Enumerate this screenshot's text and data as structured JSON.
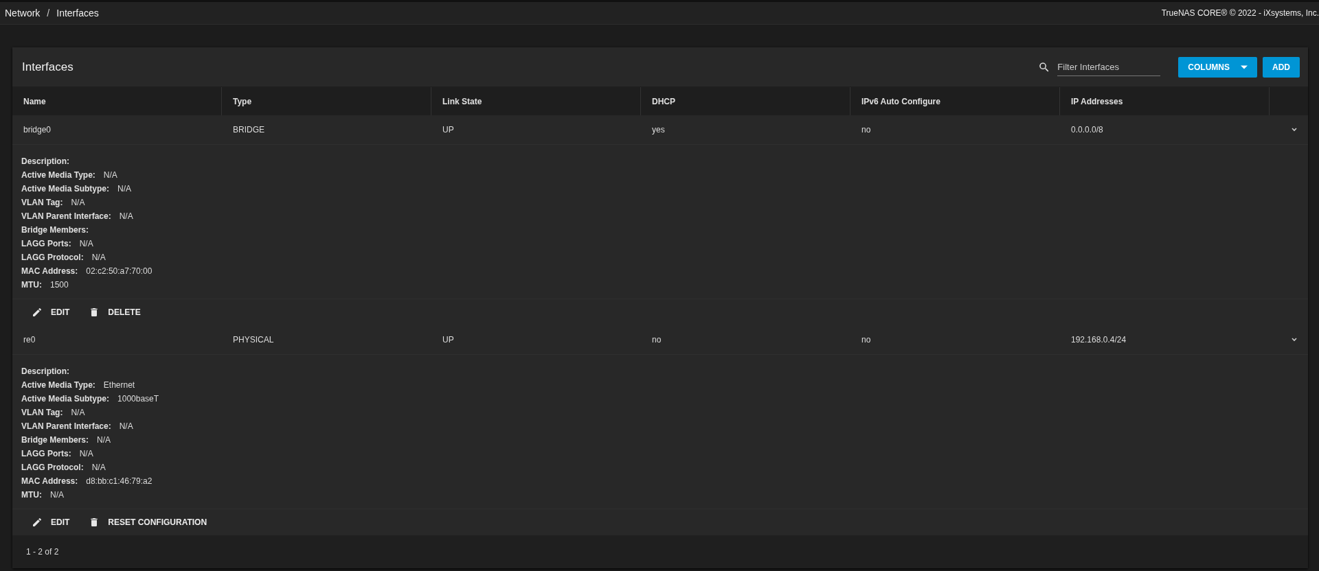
{
  "breadcrumb": {
    "items": [
      "Network",
      "Interfaces"
    ],
    "separator": "/"
  },
  "copyright": "TrueNAS CORE® © 2022 - iXsystems, Inc.",
  "card": {
    "title": "Interfaces",
    "filter": {
      "placeholder": "Filter Interfaces"
    },
    "buttons": [
      {
        "label": "COLUMNS",
        "kind": "dropdown"
      },
      {
        "label": "ADD",
        "kind": "plain"
      }
    ]
  },
  "table": {
    "columns": [
      "Name",
      "Type",
      "Link State",
      "DHCP",
      "IPv6 Auto Configure",
      "IP Addresses"
    ],
    "rows": [
      {
        "cells": [
          "bridge0",
          "BRIDGE",
          "UP",
          "yes",
          "no",
          "0.0.0.0/8"
        ],
        "expanded": true,
        "details": [
          {
            "label": "Description:"
          },
          {
            "label": "Active Media Type:",
            "value": "N/A"
          },
          {
            "label": "Active Media Subtype:",
            "value": "N/A"
          },
          {
            "label": "VLAN Tag:",
            "value": "N/A"
          },
          {
            "label": "VLAN Parent Interface:",
            "value": "N/A"
          },
          {
            "label": "Bridge Members:"
          },
          {
            "label": "LAGG Ports:",
            "value": "N/A"
          },
          {
            "label": "LAGG Protocol:",
            "value": "N/A"
          },
          {
            "label": "MAC Address:",
            "value": "02:c2:50:a7:70:00"
          },
          {
            "label": "MTU:",
            "value": "1500"
          }
        ],
        "actions": [
          {
            "label": "EDIT",
            "kind": "edit"
          },
          {
            "label": "DELETE",
            "kind": "delete"
          }
        ]
      },
      {
        "cells": [
          "re0",
          "PHYSICAL",
          "UP",
          "no",
          "no",
          "192.168.0.4/24"
        ],
        "expanded": true,
        "details": [
          {
            "label": "Description:"
          },
          {
            "label": "Active Media Type:",
            "value": "Ethernet"
          },
          {
            "label": "Active Media Subtype:",
            "value": "1000baseT"
          },
          {
            "label": "VLAN Tag:",
            "value": "N/A"
          },
          {
            "label": "VLAN Parent Interface:",
            "value": "N/A"
          },
          {
            "label": "Bridge Members:",
            "value": "N/A"
          },
          {
            "label": "LAGG Ports:",
            "value": "N/A"
          },
          {
            "label": "LAGG Protocol:",
            "value": "N/A"
          },
          {
            "label": "MAC Address:",
            "value": "d8:bb:c1:46:79:a2"
          },
          {
            "label": "MTU:",
            "value": "N/A"
          }
        ],
        "actions": [
          {
            "label": "EDIT",
            "kind": "edit"
          },
          {
            "label": "RESET CONFIGURATION",
            "kind": "delete"
          }
        ]
      }
    ]
  },
  "paginator": "1 - 2 of 2"
}
